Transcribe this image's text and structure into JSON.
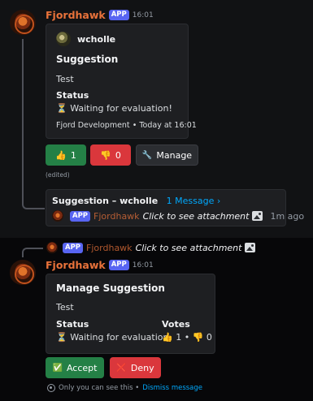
{
  "colors": {
    "bot_name": "#e8723a",
    "app_badge": "#5865f2",
    "green": "#248046",
    "red": "#da373c",
    "link": "#00a8fc"
  },
  "message1": {
    "author": "Fjordhawk",
    "badge": "APP",
    "time": "16:01",
    "embed": {
      "user": "wcholle",
      "title": "Suggestion",
      "description": "Test",
      "status_label": "Status",
      "status_icon": "⏳",
      "status_value": "Waiting for evaluation!",
      "footer_source": "Fjord Development",
      "footer_sep": "•",
      "footer_time": "Today at 16:01"
    },
    "buttons": {
      "upvote_icon": "👍",
      "upvote_count": "1",
      "downvote_icon": "👎",
      "downvote_count": "0",
      "manage_icon": "🔧",
      "manage_label": "Manage"
    },
    "edited": "(edited)"
  },
  "thread": {
    "name": "Suggestion – wcholle",
    "messages": "1 Message ›",
    "badge": "APP",
    "author": "Fjordhawk",
    "preview": "Click to see attachment",
    "time": "1m ago"
  },
  "message2": {
    "reply_badge": "APP",
    "reply_author": "Fjordhawk",
    "reply_text": "Click to see attachment",
    "author": "Fjordhawk",
    "badge": "APP",
    "time": "16:01",
    "embed": {
      "title": "Manage Suggestion",
      "description": "Test",
      "status_label": "Status",
      "status_icon": "⏳",
      "status_value": "Waiting for evaluation",
      "votes_label": "Votes",
      "votes_up_icon": "👍",
      "votes_up": "1",
      "votes_sep": "•",
      "votes_down_icon": "👎",
      "votes_down": "0"
    },
    "buttons": {
      "accept_icon": "✅",
      "accept_label": "Accept",
      "deny_icon": "❌",
      "deny_label": "Deny"
    },
    "ephemeral_text": "Only you can see this •",
    "dismiss_label": "Dismiss message"
  }
}
